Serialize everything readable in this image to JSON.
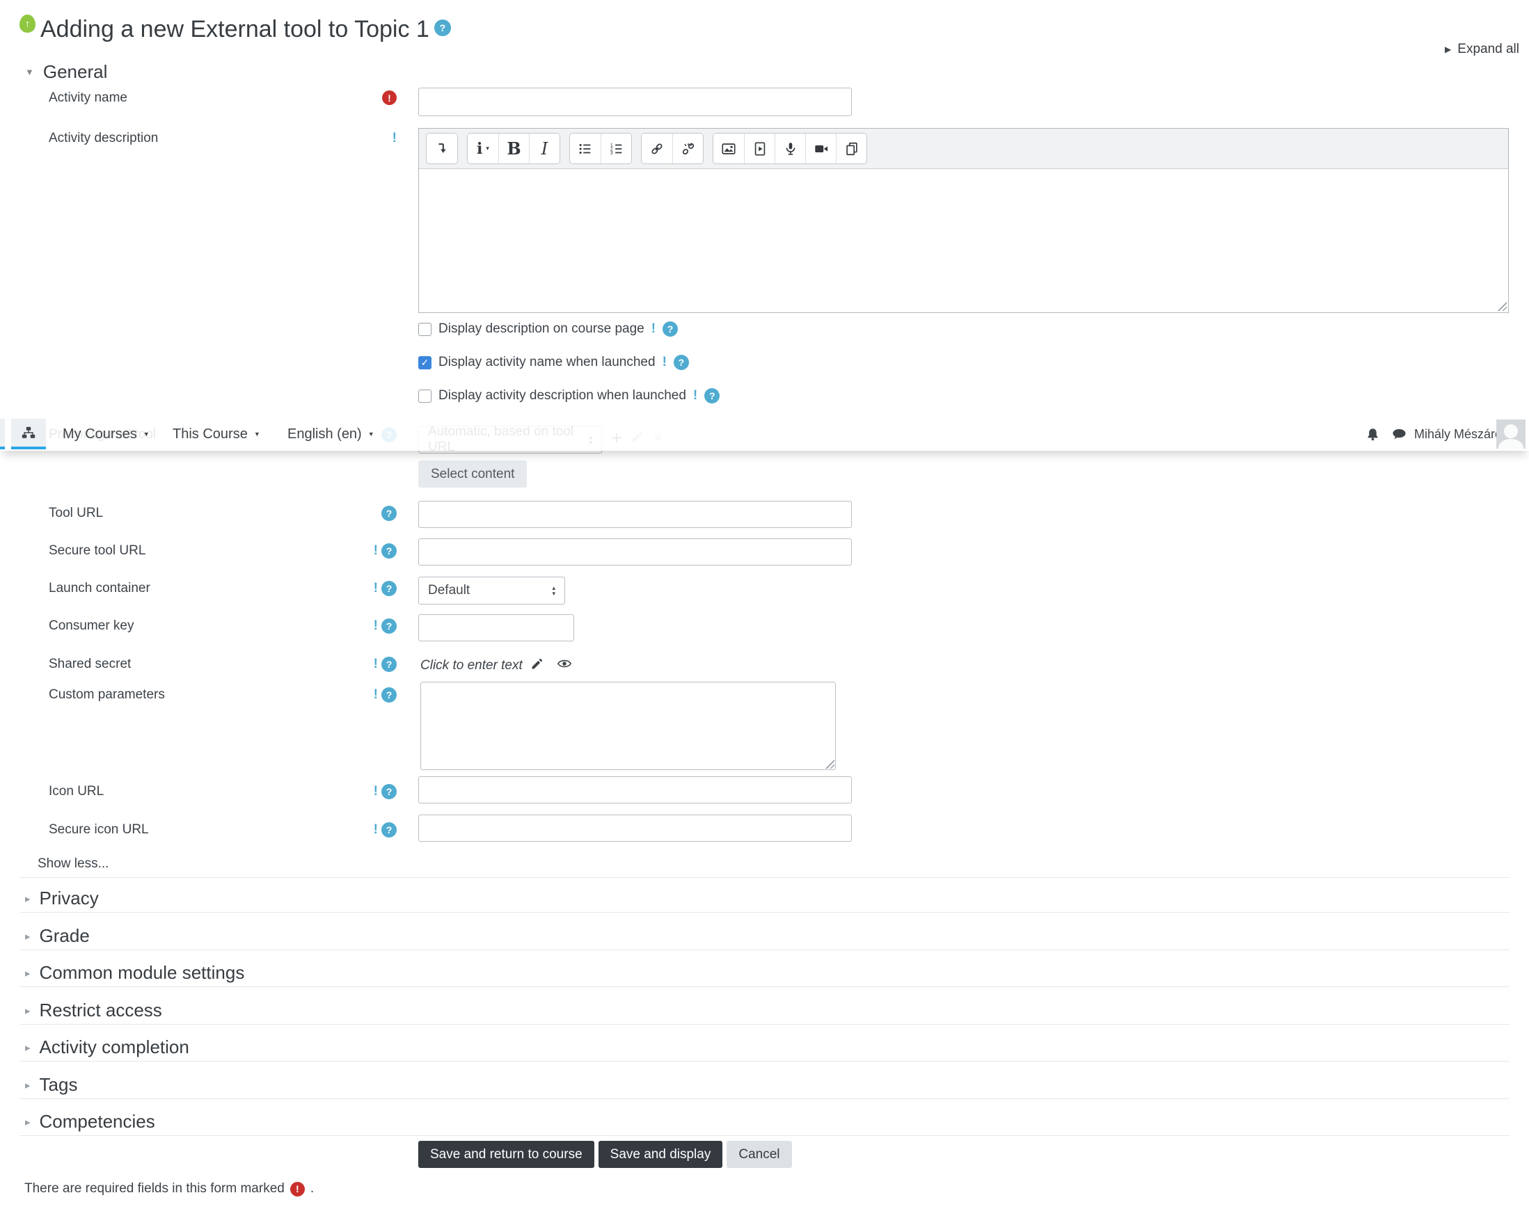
{
  "header": {
    "title": "Adding a new External tool to Topic 1",
    "expand_all": "Expand all"
  },
  "navbar": {
    "my_courses": "My Courses",
    "this_course": "This Course",
    "language": "English (en)",
    "user_name": "Mihály Mészáros"
  },
  "general": {
    "section_title": "General",
    "activity_name_label": "Activity name",
    "activity_description_label": "Activity description",
    "display_description_label": "Display description on course page",
    "display_activity_name_label": "Display activity name when launched",
    "display_activity_description_label": "Display activity description when launched",
    "preconfigured_tool_label": "Preconfigured tool",
    "preconfigured_tool_value": "Automatic, based on tool URL",
    "select_content_label": "Select content",
    "tool_url_label": "Tool URL",
    "secure_tool_url_label": "Secure tool URL",
    "launch_container_label": "Launch container",
    "launch_container_value": "Default",
    "consumer_key_label": "Consumer key",
    "shared_secret_label": "Shared secret",
    "shared_secret_value": "Click to enter text",
    "custom_parameters_label": "Custom parameters",
    "icon_url_label": "Icon URL",
    "secure_icon_url_label": "Secure icon URL",
    "show_less": "Show less..."
  },
  "editor": {
    "style_button": "i",
    "bold": "B",
    "italic": "I"
  },
  "sections": [
    "Privacy",
    "Grade",
    "Common module settings",
    "Restrict access",
    "Activity completion",
    "Tags",
    "Competencies"
  ],
  "buttons": {
    "save_return": "Save and return to course",
    "save_display": "Save and display",
    "cancel": "Cancel"
  },
  "footer": {
    "required_text": "There are required fields in this form marked",
    "period": "."
  }
}
